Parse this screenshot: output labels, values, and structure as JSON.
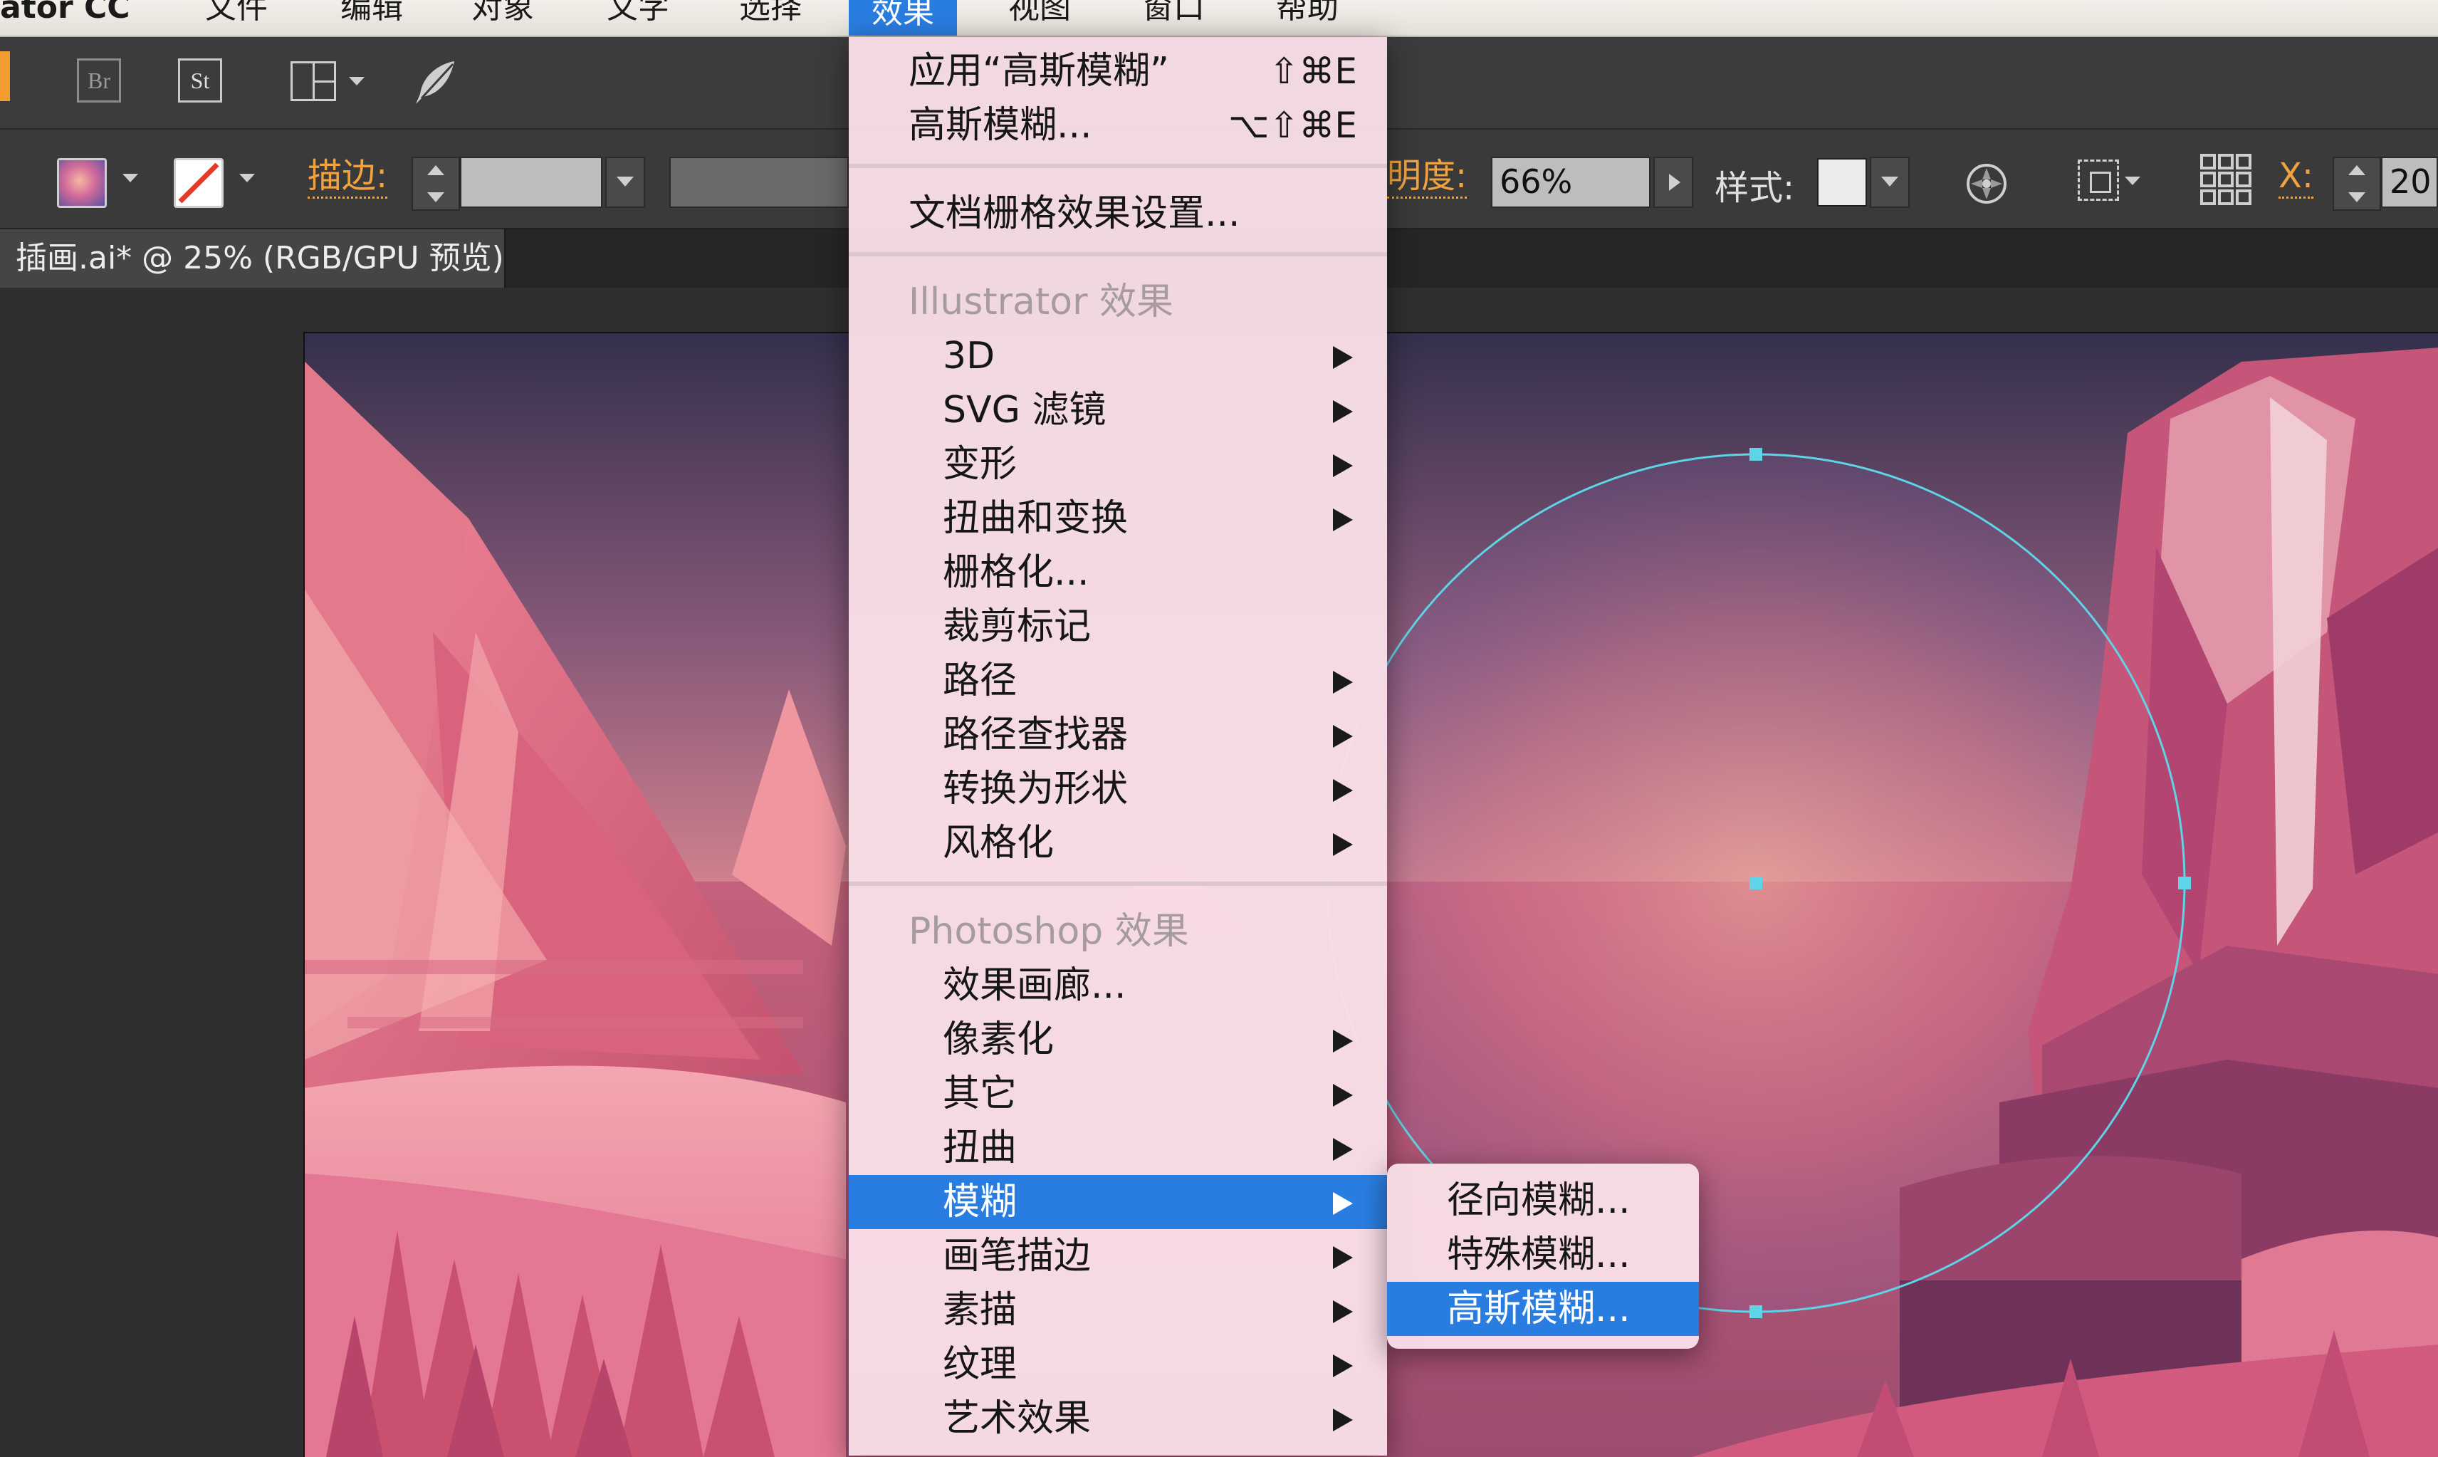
{
  "menubar": {
    "app_name": "ator CC",
    "items": [
      "文件",
      "编辑",
      "对象",
      "文字",
      "选择",
      "效果",
      "视图",
      "窗口",
      "帮助"
    ]
  },
  "appbar": {
    "bridge_label": "Br",
    "stock_label": "St"
  },
  "controlbar": {
    "stroke_label": "描边:",
    "opacity_label": "明度:",
    "opacity_value": "66%",
    "style_label": "样式:",
    "x_label": "X:",
    "x_value": "20"
  },
  "document": {
    "tab_title": "插画.ai* @ 25% (RGB/GPU 预览)"
  },
  "effects_menu": {
    "apply_last": "应用“高斯模糊”",
    "apply_last_shortcut": "⇧⌘E",
    "last_effect": "高斯模糊...",
    "last_effect_shortcut": "⌥⇧⌘E",
    "raster_settings": "文档栅格效果设置...",
    "illustrator_header": "Illustrator 效果",
    "illustrator_items": [
      "3D",
      "SVG 滤镜",
      "变形",
      "扭曲和变换",
      "栅格化...",
      "裁剪标记",
      "路径",
      "路径查找器",
      "转换为形状",
      "风格化"
    ],
    "photoshop_header": "Photoshop 效果",
    "photoshop_items": [
      "效果画廊...",
      "像素化",
      "其它",
      "扭曲",
      "模糊",
      "画笔描边",
      "素描",
      "纹理",
      "艺术效果"
    ]
  },
  "blur_submenu": {
    "items": [
      "径向模糊...",
      "特殊模糊...",
      "高斯模糊..."
    ]
  },
  "colors": {
    "menu_highlight": "#2a7de0",
    "selection": "#5fd4e6",
    "accent_orange": "#f0a340"
  }
}
